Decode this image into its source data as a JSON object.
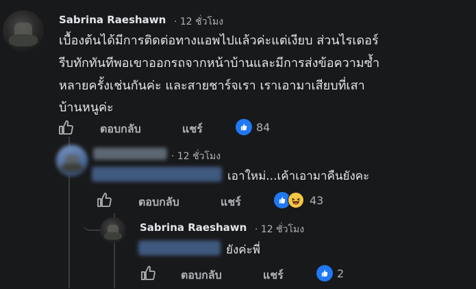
{
  "comments": [
    {
      "author": "Sabrina Raeshawn",
      "time": "· 12 ชั่วโมง",
      "lines": [
        "เบื้องต้นได้มีการติดต่อทางแอพไปแล้วค่ะแต่เงียบ ส่วนไรเดอร์",
        "รีบทักทันทีพอเขาออกรถจากหน้าบ้านและมีการส่งข้อความซ้ำ",
        "หลายครั้งเช่นกันค่ะ และสายชาร์จเรา เราเอามาเสียบที่เสา",
        "บ้านหนูค่ะ"
      ],
      "reply_label": "ตอบกลับ",
      "share_label": "แชร์",
      "reaction_count": "84",
      "reaction_icons": [
        "like-icon"
      ]
    },
    {
      "author": "",
      "time": "· 12 ชั่วโมง",
      "text": "เอาใหม่...เค้าเอามาคืนยังคะ",
      "reply_label": "ตอบกลับ",
      "share_label": "แชร์",
      "reaction_count": "43",
      "reaction_icons": [
        "like-icon",
        "haha-icon"
      ]
    },
    {
      "author": "Sabrina Raeshawn",
      "time": "· 12 ชั่วโมง",
      "text": "ยังค่ะพี่",
      "reply_label": "ตอบกลับ",
      "share_label": "แชร์",
      "reaction_count": "2",
      "reaction_icons": [
        "like-icon"
      ]
    }
  ],
  "colors": {
    "background": "#18191a",
    "text_primary": "#e4e6eb",
    "text_secondary": "#b0b3b8",
    "like_blue": "#2078f4",
    "haha_yellow": "#f7c744",
    "thread_line": "#3a3b3c"
  }
}
